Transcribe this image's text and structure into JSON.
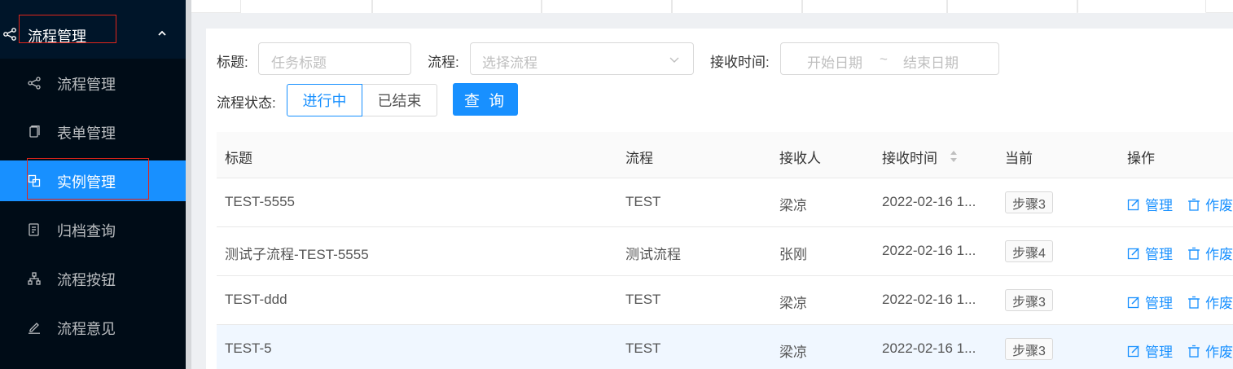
{
  "sidebar": {
    "header_title": "流程管理",
    "items": [
      {
        "label": "流程管理",
        "icon": "share-icon",
        "active": false
      },
      {
        "label": "表单管理",
        "icon": "copy-icon",
        "active": false
      },
      {
        "label": "实例管理",
        "icon": "block-icon",
        "active": true
      },
      {
        "label": "归档查询",
        "icon": "file-search-icon",
        "active": false
      },
      {
        "label": "流程按钮",
        "icon": "cluster-icon",
        "active": false
      },
      {
        "label": "流程意见",
        "icon": "edit-icon",
        "active": false
      }
    ]
  },
  "filters": {
    "title_label": "标题:",
    "title_placeholder": "任务标题",
    "flow_label": "流程:",
    "flow_placeholder": "选择流程",
    "time_label": "接收时间:",
    "start_placeholder": "开始日期",
    "range_sep": "~",
    "end_placeholder": "结束日期",
    "status_label": "流程状态:",
    "status_options": [
      "进行中",
      "已结束"
    ],
    "status_selected": "进行中",
    "query_button": "查 询"
  },
  "table": {
    "columns": [
      "标题",
      "流程",
      "接收人",
      "接收时间",
      "当前",
      "操作"
    ],
    "rows": [
      {
        "title": "TEST-5555",
        "flow": "TEST",
        "receiver": "梁凉",
        "time": "2022-02-16 1...",
        "step": "步骤3",
        "actions": [
          "管理",
          "作废"
        ]
      },
      {
        "title": "测试子流程-TEST-5555",
        "flow": "测试流程",
        "receiver": "张刚",
        "time": "2022-02-16 1...",
        "step": "步骤4",
        "actions": [
          "管理",
          "作废"
        ]
      },
      {
        "title": "TEST-ddd",
        "flow": "TEST",
        "receiver": "梁凉",
        "time": "2022-02-16 1...",
        "step": "步骤3",
        "actions": [
          "管理",
          "作废"
        ]
      },
      {
        "title": "TEST-5",
        "flow": "TEST",
        "receiver": "梁凉",
        "time": "2022-02-16 1...",
        "step": "步骤3",
        "actions": [
          "管理",
          "作废"
        ]
      }
    ]
  },
  "colors": {
    "primary": "#1890ff",
    "sidebar": "#001529",
    "annotation": "#e0251b"
  }
}
